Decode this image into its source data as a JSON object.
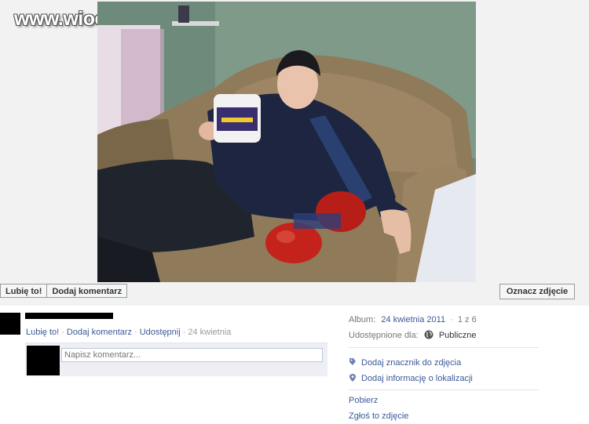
{
  "watermark": "www.wiocha.pl",
  "photo_actions": {
    "like_label": "Lubię to!",
    "comment_label": "Dodaj komentarz",
    "tag_label": "Oznacz zdjęcie"
  },
  "post": {
    "actions": {
      "like": "Lubię to!",
      "comment": "Dodaj komentarz",
      "share": "Udostępnij",
      "date": "24 kwietnia"
    },
    "comment_placeholder": "Napisz komentarz..."
  },
  "sidebar": {
    "album_label": "Album:",
    "album_name": "24 kwietnia 2011",
    "album_position": "1 z 6",
    "shared_label": "Udostępnione dla:",
    "shared_value": "Publiczne",
    "links": [
      {
        "label": "Dodaj znacznik do zdjęcia",
        "icon": "tag-icon"
      },
      {
        "label": "Dodaj informację o lokalizacji",
        "icon": "location-pin-icon"
      }
    ],
    "download_label": "Pobierz",
    "report_label": "Zgłoś to zdjęcie"
  },
  "colors": {
    "link": "#3b5998",
    "button_bg": "#f5f6f7",
    "comment_bg": "#edeff4"
  }
}
